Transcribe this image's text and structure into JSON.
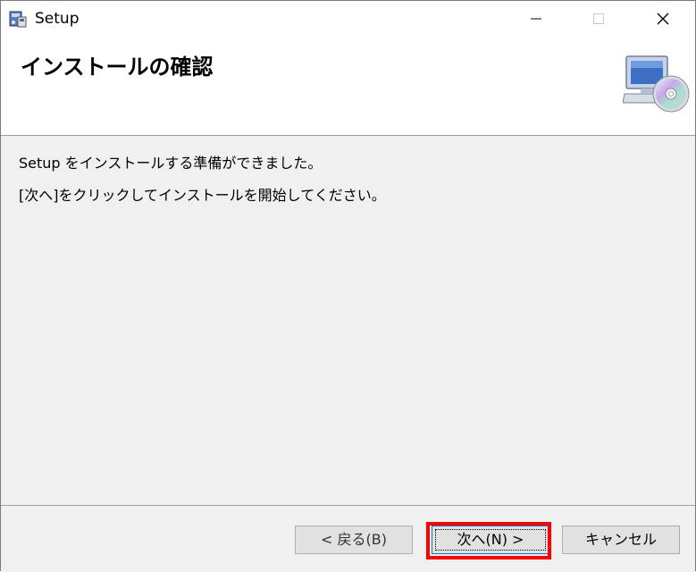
{
  "window": {
    "title": "Setup",
    "controls": {
      "minimize_icon": "minimize-icon",
      "maximize_icon": "maximize-icon",
      "close_icon": "close-icon"
    }
  },
  "banner": {
    "title": "インストールの確認",
    "icon": "computer-cd-icon"
  },
  "content": {
    "message1": "Setup をインストールする準備ができました。",
    "message2": "[次へ]をクリックしてインストールを開始してください。"
  },
  "footer": {
    "back_label": "< 戻る(B)",
    "next_label": "次へ(N) >",
    "cancel_label": "キャンセル"
  },
  "colors": {
    "highlight": "#ff0000",
    "dialog_bg": "#f0f0f0",
    "button_bg": "#e1e1e1",
    "focus_border": "#0078d7"
  }
}
